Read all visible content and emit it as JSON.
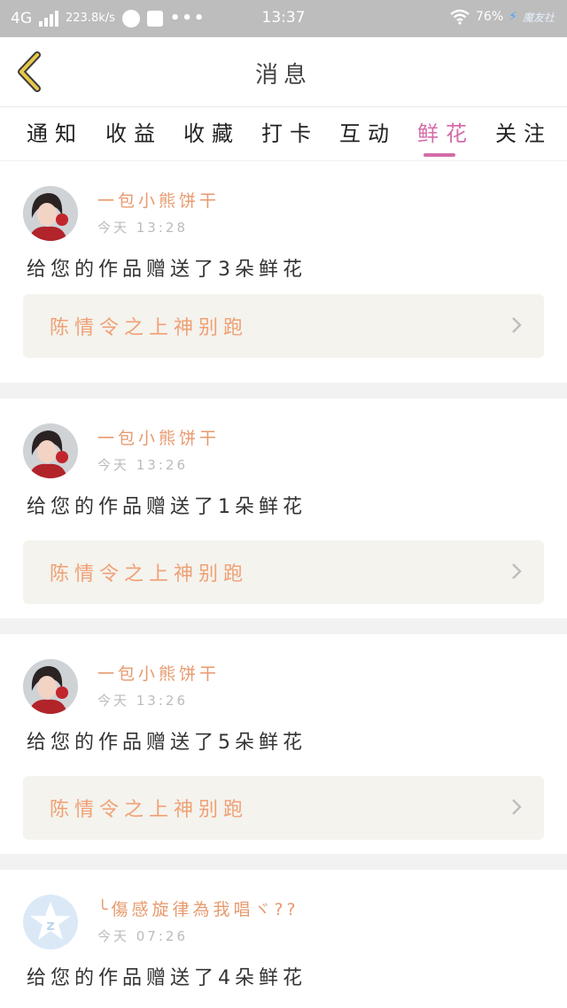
{
  "status_bar": {
    "network": "4G",
    "speed": "223.8k/s",
    "menu_dots": "•••",
    "time": "13:37",
    "battery": "76%",
    "brand": "魔友社"
  },
  "header": {
    "title": "消息"
  },
  "tabs": [
    {
      "label": "通知",
      "active": false
    },
    {
      "label": "收益",
      "active": false
    },
    {
      "label": "收藏",
      "active": false
    },
    {
      "label": "打卡",
      "active": false
    },
    {
      "label": "互动",
      "active": false
    },
    {
      "label": "鲜花",
      "active": true
    },
    {
      "label": "关注",
      "active": false
    }
  ],
  "messages": [
    {
      "user": "一包小熊饼干",
      "time": "今天 13:28",
      "text": "给您的作品赠送了3朵鲜花",
      "work": "陈情令之上神别跑",
      "avatar": "girl-photo"
    },
    {
      "user": "一包小熊饼干",
      "time": "今天 13:26",
      "text": "给您的作品赠送了1朵鲜花",
      "work": "陈情令之上神别跑",
      "avatar": "girl-photo"
    },
    {
      "user": "一包小熊饼干",
      "time": "今天 13:26",
      "text": "给您的作品赠送了5朵鲜花",
      "work": "陈情令之上神别跑",
      "avatar": "girl-photo"
    },
    {
      "user": "╰傷感旋律為我唱ヾ??",
      "time": "今天 07:26",
      "text": "给您的作品赠送了4朵鲜花",
      "avatar": "default-star"
    }
  ],
  "colors": {
    "accent": "#d46ca8",
    "username": "#e79a6e",
    "work_title": "#f0a074",
    "back_arrow": "#e8c84a"
  }
}
